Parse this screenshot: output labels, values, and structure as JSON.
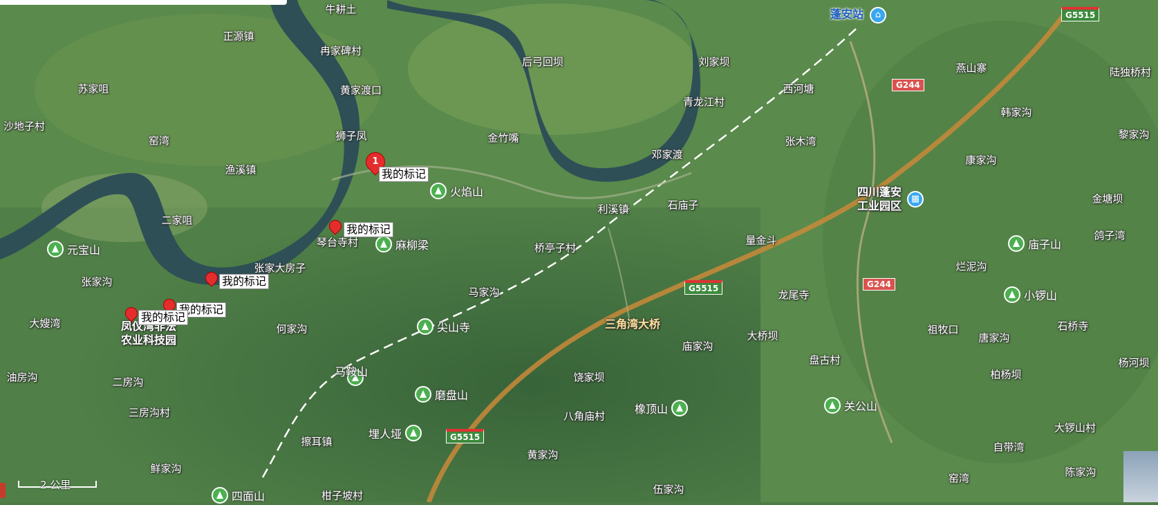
{
  "map": {
    "scale_label": "2 公里",
    "colors": {
      "river": "#2f4f57",
      "road": "#c98a3a",
      "rail": "#ffffff",
      "poi_mountain": "#4caf50",
      "marker": "#e52d2d"
    }
  },
  "places": [
    "牛耕土",
    "正源镇",
    "苏家咀",
    "沙地子村",
    "窑湾",
    "渔溪镇",
    "冉家碑村",
    "黄家渡口",
    "狮子凤",
    "后弓回坝",
    "金竹嘴",
    "青龙江村",
    "西河塘",
    "邓家渡",
    "张木湾",
    "利溪镇",
    "石庙子",
    "桥亭子村",
    "量金斗",
    "燕山寨",
    "韩家沟",
    "康家沟",
    "金塘坝",
    "鸽子湾",
    "烂泥沟",
    "陆独桥村",
    "黎家沟",
    "琴台寺村",
    "张家大房子",
    "张家沟",
    "大嫂湾",
    "何家沟",
    "马家沟",
    "龙尾寺",
    "大桥坝",
    "庙家沟",
    "盘古村",
    "祖牧口",
    "唐家沟",
    "石桥寺",
    "杨河坝",
    "柏杨坝",
    "油房沟",
    "二房沟",
    "三房沟村",
    "擦耳镇",
    "饶家坝",
    "八角庙村",
    "黄家沟",
    "鲜家沟",
    "窑湾",
    "陈家沟",
    "自带湾",
    "大锣山村",
    "伍家沟",
    "二家咀",
    "刘家坝",
    "柑子坡村"
  ],
  "big_labels": {
    "park": "凤仪湾非法\n农业科技园",
    "industrial": "四川蓬安\n工业园区",
    "bridge": "三角湾大桥",
    "station": "蓬安站"
  },
  "mountains": [
    "火焰山",
    "元宝山",
    "麻柳梁",
    "尖山寺",
    "马鞍山",
    "磨盘山",
    "埋人垭",
    "橡顶山",
    "关公山",
    "小锣山",
    "庙子山",
    "四面山"
  ],
  "shields": {
    "g5515_a": "G5515",
    "g5515_b": "G5515",
    "g5515_c": "G5515",
    "g244_a": "G244",
    "g244_b": "G244"
  },
  "markers": {
    "cluster_count": "1",
    "label": "我的标记"
  }
}
